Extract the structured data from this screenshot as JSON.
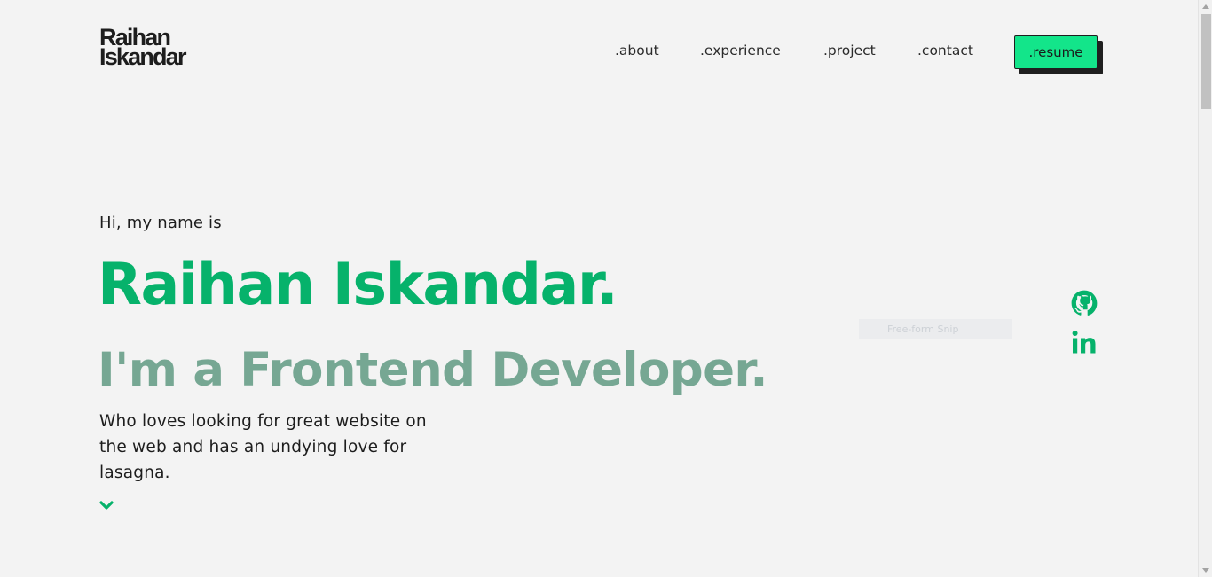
{
  "logo": {
    "line1": "Raihan",
    "line2": "Iskandar"
  },
  "nav": {
    "about": ".about",
    "experience": ".experience",
    "project": ".project",
    "contact": ".contact",
    "resume": ".resume"
  },
  "hero": {
    "greeting": "Hi, my name is",
    "name": "Raihan Iskandar.",
    "role": "I'm a Frontend Developer.",
    "description": "Who loves looking for great website on the web and has an undying love for lasagna."
  },
  "social": {
    "github_icon": "github-icon",
    "linkedin_icon": "linkedin-icon"
  },
  "snip": {
    "label": "Free-form Snip"
  },
  "colors": {
    "background": "#f3f3f3",
    "accent": "#06b26b",
    "accent_bright": "#13e58a",
    "role_color": "#76a793",
    "text": "#1d1d1d"
  }
}
